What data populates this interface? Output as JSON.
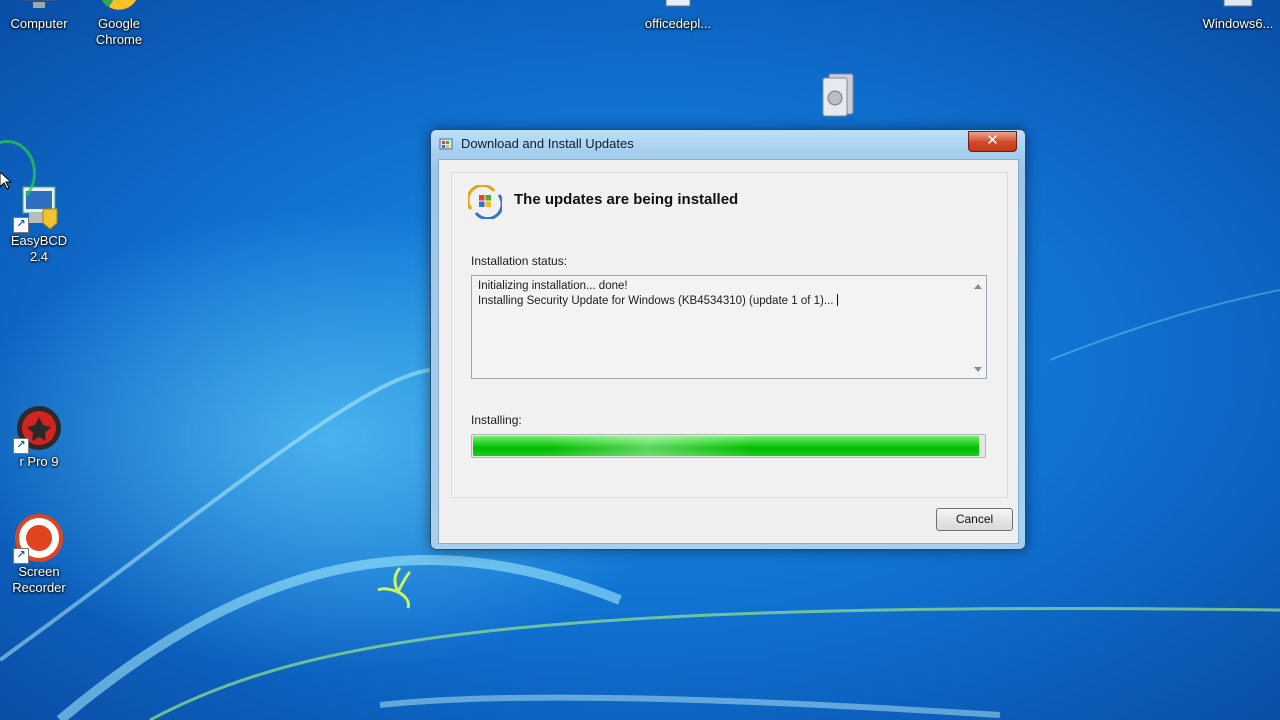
{
  "desktop": {
    "icons": [
      {
        "label": "Computer"
      },
      {
        "label": "Google\nChrome"
      },
      {
        "label": "officedepl..."
      },
      {
        "label": "Windows6..."
      },
      {
        "label": "EasyBCD 2.4"
      },
      {
        "label": "r Pro 9"
      },
      {
        "label": "Screen\nRecorder"
      }
    ]
  },
  "dialog": {
    "title": "Download and Install Updates",
    "close_glyph": "✕",
    "header": "The updates are being installed",
    "status_label": "Installation status:",
    "status_lines": [
      "Initializing installation... done!",
      "Installing Security Update for Windows (KB4534310) (update 1 of 1)..."
    ],
    "progress_label": "Installing:",
    "progress_fraction": 0.99,
    "cancel_label": "Cancel"
  },
  "colors": {
    "progress": "#13c613",
    "desktop_blue": "#0f6fcf"
  },
  "icons": {
    "title": "windows-update-icon",
    "header": "windows-update-icon",
    "close": "close-icon"
  }
}
